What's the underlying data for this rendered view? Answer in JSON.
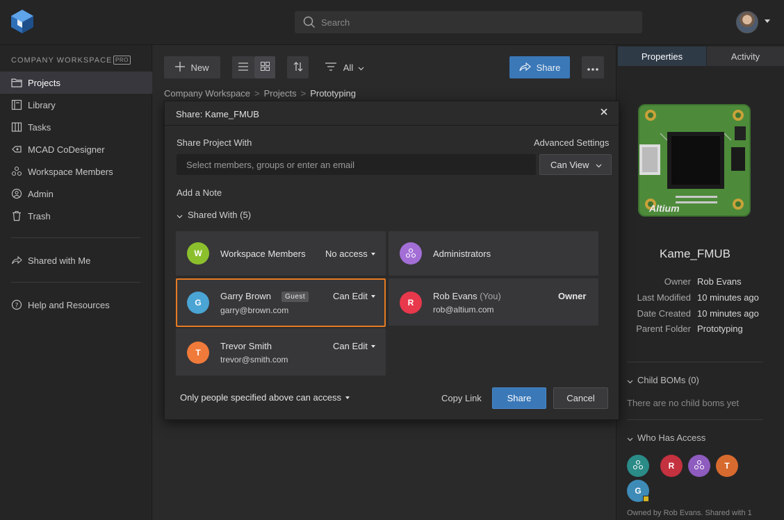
{
  "header": {
    "search_placeholder": "Search"
  },
  "sidebar": {
    "workspace_label": "COMPANY WORKSPACE",
    "badge": "PRO",
    "items": [
      {
        "label": "Projects",
        "icon": "folder-icon"
      },
      {
        "label": "Library",
        "icon": "library-icon"
      },
      {
        "label": "Tasks",
        "icon": "tasks-icon"
      },
      {
        "label": "MCAD CoDesigner",
        "icon": "mcad-icon"
      },
      {
        "label": "Workspace Members",
        "icon": "members-icon"
      },
      {
        "label": "Admin",
        "icon": "admin-icon"
      },
      {
        "label": "Trash",
        "icon": "trash-icon"
      }
    ],
    "shared_with_me": "Shared with Me",
    "help": "Help and Resources"
  },
  "toolbar": {
    "new_label": "New",
    "filter_label": "All",
    "share_label": "Share"
  },
  "breadcrumb": [
    "Company Workspace",
    "Projects",
    "Prototyping"
  ],
  "right_panel": {
    "tabs": [
      "Properties",
      "Activity"
    ],
    "project_name": "Kame_FMUB",
    "properties": [
      {
        "key": "Owner",
        "value": "Rob Evans"
      },
      {
        "key": "Last Modified",
        "value": "10 minutes ago"
      },
      {
        "key": "Date Created",
        "value": "10 minutes ago"
      },
      {
        "key": "Parent Folder",
        "value": "Prototyping"
      }
    ],
    "child_boms_title": "Child BOMs (0)",
    "child_boms_empty": "There are no child boms yet",
    "who_has_access_title": "Who Has Access",
    "access_avatars": [
      "R",
      "T",
      "G"
    ],
    "owned_by": "Owned by Rob Evans. Shared with 1",
    "pcb_text": "Altium"
  },
  "dialog": {
    "title": "Share: Kame_FMUB",
    "share_with_label": "Share Project With",
    "advanced_settings": "Advanced Settings",
    "member_placeholder": "Select members, groups or enter an email",
    "permission_default": "Can View",
    "add_note": "Add a Note",
    "shared_with_title": "Shared With (5)",
    "shares": [
      {
        "initial": "W",
        "name": "Workspace Members",
        "email": "",
        "permission": "No access",
        "color": "#8bc02c"
      },
      {
        "initial": "",
        "name": "Administrators",
        "email": "",
        "permission": "",
        "color": "#a36fd6"
      },
      {
        "initial": "G",
        "name": "Garry Brown",
        "badge": "Guest",
        "email": "garry@brown.com",
        "permission": "Can Edit",
        "color": "#4aa4d4"
      },
      {
        "initial": "R",
        "name": "Rob Evans",
        "you": "(You)",
        "email": "rob@altium.com",
        "permission": "Owner",
        "color": "#e8384c"
      },
      {
        "initial": "T",
        "name": "Trevor Smith",
        "email": "trevor@smith.com",
        "permission": "Can Edit",
        "color": "#f07a3a"
      }
    ],
    "access_scope": "Only people specified above can access",
    "copy_link": "Copy Link",
    "share_button": "Share",
    "cancel_button": "Cancel"
  },
  "colors": {
    "accent_blue": "#3a78b8",
    "link_blue": "#3f9dde",
    "selected_orange": "#e67b22"
  }
}
